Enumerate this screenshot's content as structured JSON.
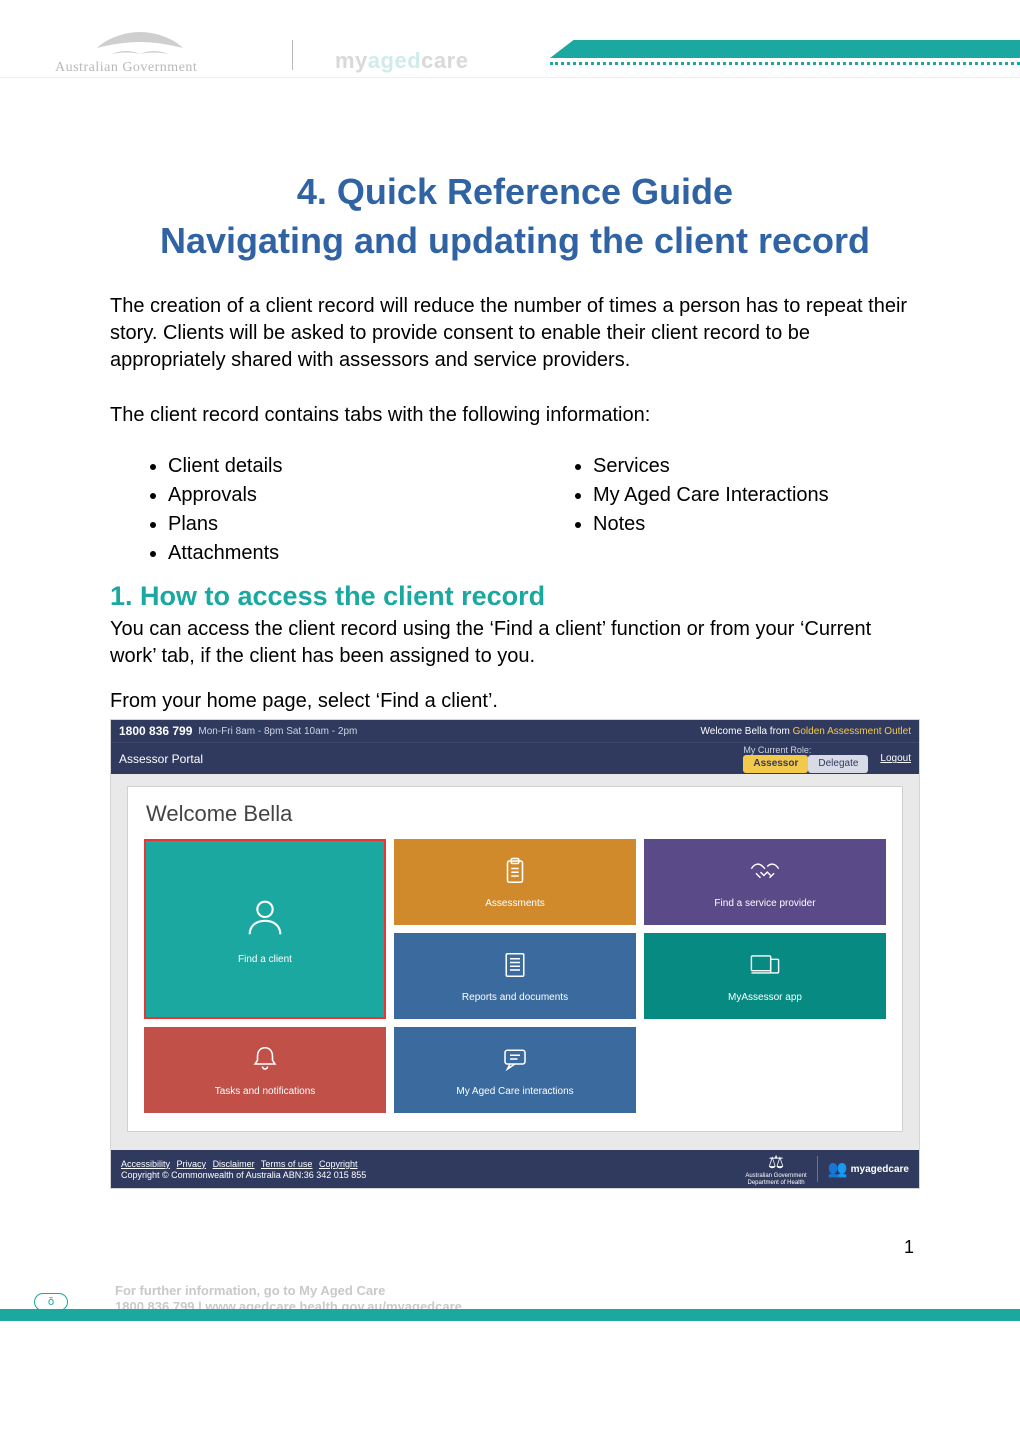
{
  "header": {
    "govt_label": "Australian Government",
    "brand": {
      "prefix": "my",
      "mid": "aged",
      "suffix": "care"
    }
  },
  "doc": {
    "title_line1": "4. Quick Reference Guide",
    "title_line2": "Navigating and updating the client record",
    "intro1": "The creation of a client record will reduce the number of times a person has to repeat their story. Clients will be asked to provide consent to enable their client record to be appropriately shared with assessors and service providers.",
    "intro2": "The client record contains tabs with the following information:",
    "bullets_left": [
      "Client details",
      "Approvals",
      "Plans",
      "Attachments"
    ],
    "bullets_right": [
      "Services",
      "My Aged Care Interactions",
      "Notes"
    ],
    "section1_heading": "1. How to access the client record",
    "section1_p": "You can access the client record using the ‘Find a client’ function or from your ‘Current work’ tab, if the client has been assigned to you.",
    "section1_step": "From your home page, select ‘Find a client’."
  },
  "portal": {
    "phone": "1800 836 799",
    "hours": "Mon-Fri 8am - 8pm Sat 10am - 2pm",
    "welcome_prefix": "Welcome Bella from",
    "welcome_org": "Golden Assessment Outlet",
    "portal_label": "Assessor Portal",
    "role_label": "My Current Role:",
    "role_assessor": "Assessor",
    "role_delegate": "Delegate",
    "logout": "Logout",
    "card_welcome": "Welcome Bella",
    "tiles": {
      "find_client": "Find a client",
      "assessments": "Assessments",
      "find_provider": "Find a service provider",
      "reports": "Reports and documents",
      "myassessor": "MyAssessor app",
      "tasks": "Tasks and notifications",
      "interactions": "My Aged Care interactions"
    },
    "footer_links": [
      "Accessibility",
      "Privacy",
      "Disclaimer",
      "Terms of use",
      "Copyright"
    ],
    "footer_copy": "Copyright © Commonwealth of Australia ABN:36 342 015 855",
    "crest_line1": "Australian Government",
    "crest_line2": "Department of Health",
    "mac_brand": "myagedcare"
  },
  "footer": {
    "page_number": "1",
    "info_line1": "For further information, go to My Aged Care",
    "info_line2": "1800 836 799 | www.agedcare.health.gov.au/myagedcare",
    "badge_char": "ŏ"
  }
}
